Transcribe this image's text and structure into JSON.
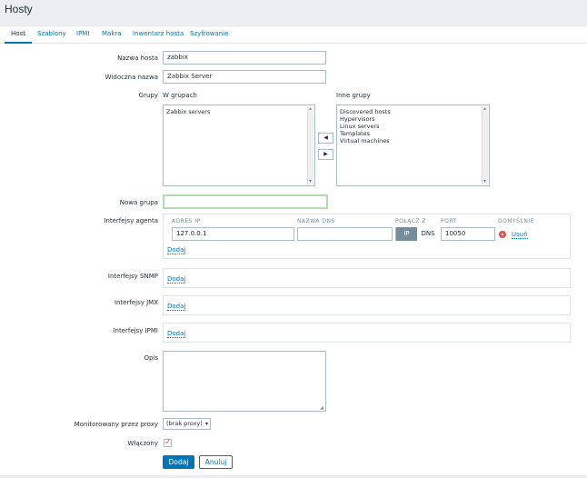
{
  "page": {
    "title": "Hosty"
  },
  "tabs": [
    "Host",
    "Szablony",
    "IPMI",
    "Makra",
    "Inwentarz hosta",
    "Szyfrowanie"
  ],
  "form": {
    "hostname_label": "Nazwa hosta",
    "hostname_value": "zabbix",
    "visible_name_label": "Widoczna nazwa",
    "visible_name_value": "Zabbix Server",
    "groups_label": "Grupy",
    "in_groups_label": "W grupach",
    "other_groups_label": "Inne grupy",
    "in_groups": [
      "Zabbix servers"
    ],
    "other_groups": [
      "Discovered hosts",
      "Hypervisors",
      "Linux servers",
      "Templates",
      "Virtual machines"
    ],
    "move_left": "◀",
    "move_right": "▶",
    "new_group_label": "Nowa grupa",
    "new_group_value": "",
    "agent_label": "Interfejsy agenta",
    "columns": {
      "ip": "ADRES IP",
      "dns": "NAZWA DNS",
      "connect": "POŁĄCZ Z",
      "port": "PORT",
      "default": "DOMYŚLNIE"
    },
    "agent_interface": {
      "ip": "127.0.0.1",
      "dns": "",
      "connect_ip": "IP",
      "connect_dns": "DNS",
      "port": "10050",
      "remove": "Usuń"
    },
    "add_link": "Dodaj",
    "snmp_label": "Interfejsy SNMP",
    "jmx_label": "Interfejsy JMX",
    "ipmi_label": "Interfejsy IPMI",
    "description_label": "Opis",
    "description_value": "",
    "proxy_label": "Monitorowany przez proxy",
    "proxy_value": "(brak proxy)",
    "enabled_label": "Włączony",
    "enabled": true,
    "submit": "Dodaj",
    "cancel": "Anuluj"
  },
  "colors": {
    "accent": "#0275b8",
    "checkbox": "#e45959"
  }
}
